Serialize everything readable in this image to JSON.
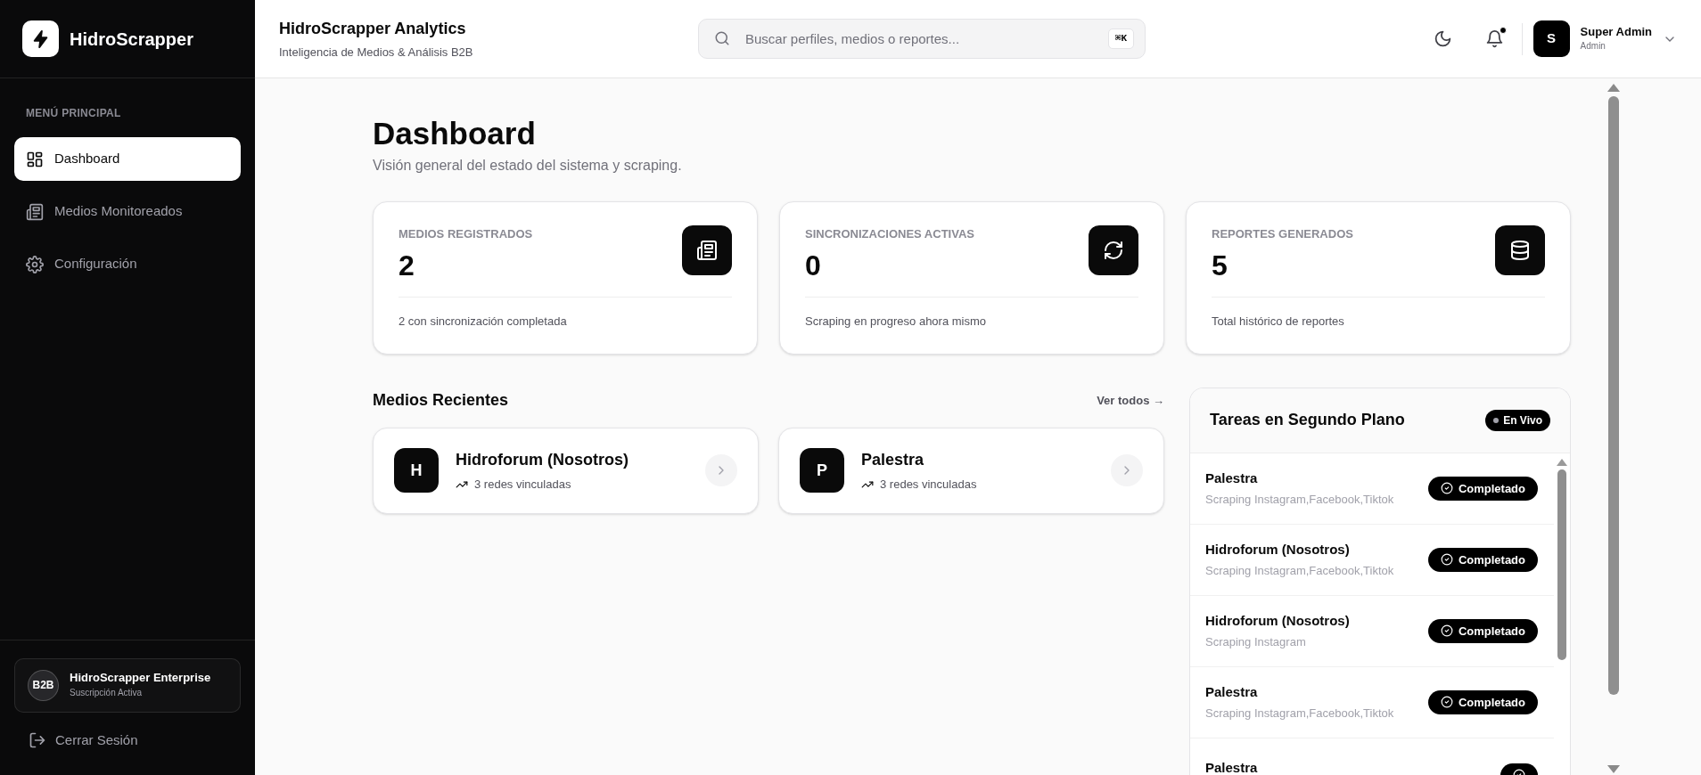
{
  "sidebar": {
    "brand": "HidroScrapper",
    "section_label": "MENÚ PRINCIPAL",
    "items": [
      {
        "label": "Dashboard",
        "selected": true
      },
      {
        "label": "Medios Monitoreados",
        "selected": false
      },
      {
        "label": "Configuración",
        "selected": false
      }
    ],
    "plan": {
      "badge": "B2B",
      "name": "HidroScrapper Enterprise",
      "status": "Suscripción Activa"
    },
    "logout": "Cerrar Sesión"
  },
  "header": {
    "title": "HidroScrapper Analytics",
    "subtitle": "Inteligencia de Medios & Análisis B2B",
    "search": {
      "placeholder": "Buscar perfiles, medios o reportes...",
      "shortcut": "⌘K"
    },
    "notifications_unread": true,
    "user": {
      "initial": "S",
      "name": "Super Admin",
      "role": "Admin"
    }
  },
  "page": {
    "title": "Dashboard",
    "subtitle": "Visión general del estado del sistema y scraping."
  },
  "stats": [
    {
      "label": "MEDIOS REGISTRADOS",
      "value": "2",
      "note": "2 con sincronización completada"
    },
    {
      "label": "SINCRONIZACIONES ACTIVAS",
      "value": "0",
      "note": "Scraping en progreso ahora mismo"
    },
    {
      "label": "REPORTES GENERADOS",
      "value": "5",
      "note": "Total histórico de reportes"
    }
  ],
  "recent": {
    "title": "Medios Recientes",
    "link": "Ver todos →",
    "items": [
      {
        "initial": "H",
        "name": "Hidroforum (Nosotros)",
        "meta": "3 redes vinculadas"
      },
      {
        "initial": "P",
        "name": "Palestra",
        "meta": "3 redes vinculadas"
      }
    ]
  },
  "tasks": {
    "title": "Tareas en Segundo Plano",
    "live_badge": "En Vivo",
    "items": [
      {
        "name": "Palestra",
        "detail": "Scraping Instagram,Facebook,Tiktok",
        "status_label": "Completado"
      },
      {
        "name": "Hidroforum (Nosotros)",
        "detail": "Scraping Instagram,Facebook,Tiktok",
        "status_label": "Completado"
      },
      {
        "name": "Hidroforum (Nosotros)",
        "detail": "Scraping Instagram",
        "status_label": "Completado"
      },
      {
        "name": "Palestra",
        "detail": "Scraping Instagram,Facebook,Tiktok",
        "status_label": "Completado"
      },
      {
        "name": "Palestra"
      }
    ]
  }
}
